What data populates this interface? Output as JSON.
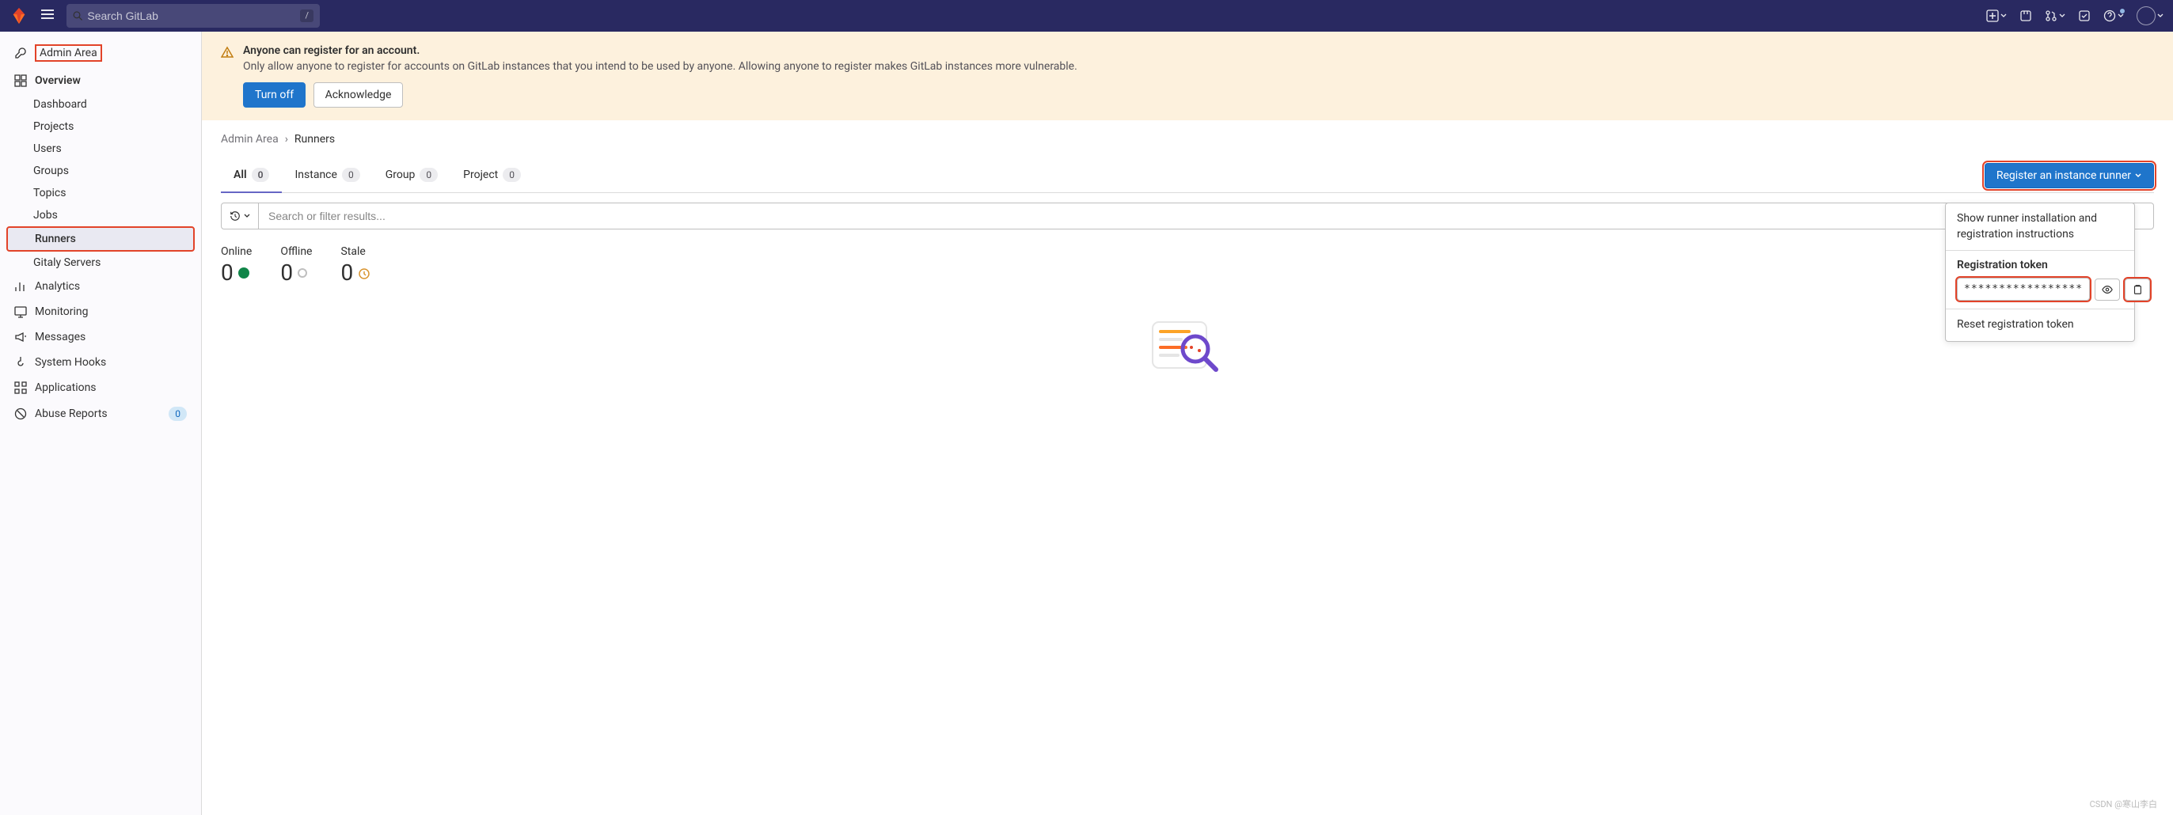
{
  "topbar": {
    "search_placeholder": "Search GitLab",
    "search_kbd": "/"
  },
  "sidebar": {
    "admin_area": "Admin Area",
    "overview": {
      "label": "Overview",
      "items": [
        "Dashboard",
        "Projects",
        "Users",
        "Groups",
        "Topics",
        "Jobs",
        "Runners",
        "Gitaly Servers"
      ]
    },
    "analytics": "Analytics",
    "monitoring": "Monitoring",
    "messages": "Messages",
    "system_hooks": "System Hooks",
    "applications": "Applications",
    "abuse_reports": "Abuse Reports",
    "abuse_count": "0"
  },
  "alert": {
    "title": "Anyone can register for an account.",
    "desc": "Only allow anyone to register for accounts on GitLab instances that you intend to be used by anyone. Allowing anyone to register makes GitLab instances more vulnerable.",
    "turn_off": "Turn off",
    "acknowledge": "Acknowledge"
  },
  "breadcrumb": {
    "parent": "Admin Area",
    "current": "Runners"
  },
  "tabs": {
    "all": {
      "label": "All",
      "count": "0"
    },
    "instance": {
      "label": "Instance",
      "count": "0"
    },
    "group": {
      "label": "Group",
      "count": "0"
    },
    "project": {
      "label": "Project",
      "count": "0"
    }
  },
  "register_button": "Register an instance runner",
  "filter_placeholder": "Search or filter results...",
  "stats": {
    "online": {
      "label": "Online",
      "value": "0"
    },
    "offline": {
      "label": "Offline",
      "value": "0"
    },
    "stale": {
      "label": "Stale",
      "value": "0"
    }
  },
  "dropdown": {
    "show_instructions": "Show runner installation and registration instructions",
    "token_label": "Registration token",
    "token_value": "*****************",
    "reset": "Reset registration token"
  },
  "watermark": "CSDN @寒山李白"
}
